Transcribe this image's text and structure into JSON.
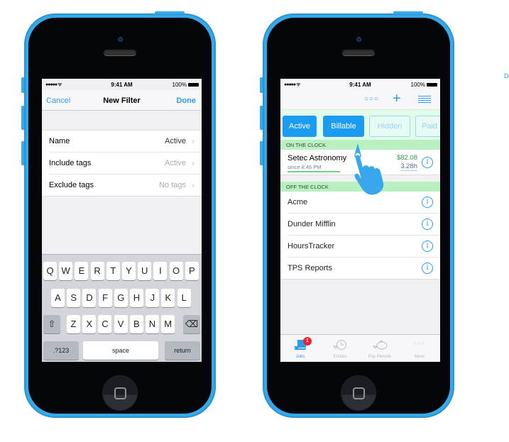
{
  "phones": [
    {
      "status": {
        "signal": "●●●●● ᯤ",
        "time": "9:41 AM",
        "battery": "100%"
      },
      "nav": {
        "left": "Cancel",
        "title": "New Filter",
        "right": "Done"
      },
      "rows": [
        {
          "label": "Name",
          "value": "Active"
        },
        {
          "label": "Include tags",
          "value": "Active"
        },
        {
          "label": "Exclude tags",
          "value": "No tags"
        }
      ],
      "keyboard": {
        "row1": [
          "Q",
          "W",
          "E",
          "R",
          "T",
          "Y",
          "U",
          "I",
          "O",
          "P"
        ],
        "row2": [
          "A",
          "S",
          "D",
          "F",
          "G",
          "H",
          "J",
          "K",
          "L"
        ],
        "row3": [
          "Z",
          "X",
          "C",
          "V",
          "B",
          "N",
          "M"
        ],
        "shift": "⇧",
        "delete": "⌫",
        "numbers": ".?123",
        "space": "space",
        "return": "return"
      }
    },
    {
      "status": {
        "signal": "●●●●● ᯤ",
        "time": "9:41 AM",
        "battery": "100%"
      },
      "nav": {
        "more": "○○○",
        "add": "+",
        "list_icon": "list-icon"
      },
      "filters": [
        "Active",
        "Billable",
        "Hidden",
        "Paid"
      ],
      "on_section": "ON THE CLOCK",
      "active_job": {
        "name": "Setec Astronomy",
        "since": "since 8:45 PM",
        "amount": "$82.08",
        "hours": "3.28h"
      },
      "off_section": "OFF THE CLOCK",
      "jobs": [
        "Acme",
        "Dunder Mifflin",
        "HoursTracker",
        "TPS Reports"
      ],
      "info_glyph": "i",
      "tabs": [
        {
          "label": "Jobs",
          "badge": "1"
        },
        {
          "label": "Entries"
        },
        {
          "label": "Pay Periods"
        },
        {
          "label": "More"
        }
      ]
    }
  ],
  "edge_text": "D",
  "colors": {
    "accent": "#2a9bf0",
    "phone_body": "#36a9e8",
    "section_green": "#b9f0c0",
    "badge_red": "#f2202e"
  }
}
